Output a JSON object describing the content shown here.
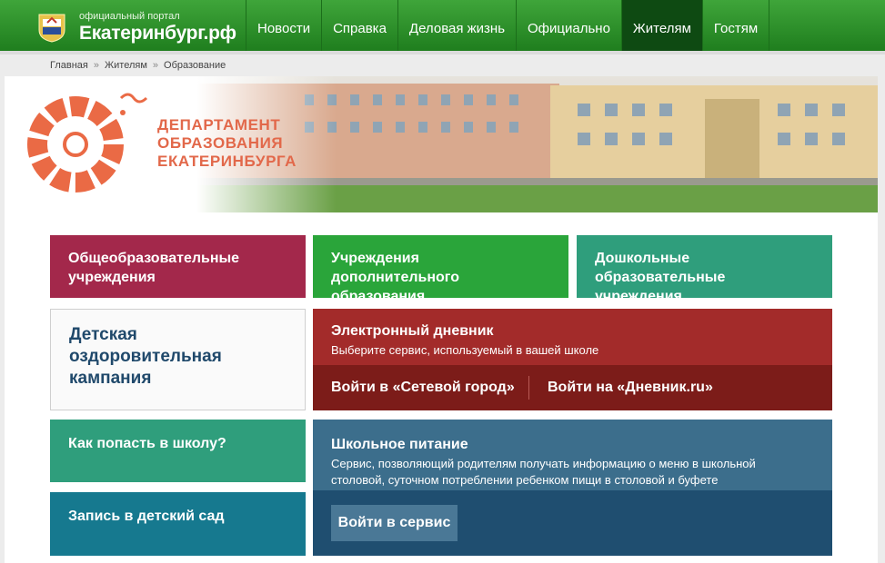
{
  "header": {
    "subtitle": "официальный портал",
    "title": "Екатеринбург.рф",
    "nav": [
      {
        "label": "Новости"
      },
      {
        "label": "Справка"
      },
      {
        "label": "Деловая жизнь"
      },
      {
        "label": "Официально"
      },
      {
        "label": "Жителям"
      },
      {
        "label": "Гостям"
      }
    ],
    "active_nav": "Жителям",
    "colors": {
      "bar": "#2a8f28",
      "active": "#0e4a12"
    }
  },
  "breadcrumb": [
    "Главная",
    "Жителям",
    "Образование"
  ],
  "breadcrumb_sep": "»",
  "banner": {
    "dept_line1": "ДЕПАРТАМЕНТ",
    "dept_line2": "ОБРАЗОВАНИЯ",
    "dept_line3": "ЕКАТЕРИНБУРГА",
    "logo_icon": "department-wreath-logo",
    "accent": "#e2684a"
  },
  "tiles": {
    "general": {
      "line1": "Общеобразовательные",
      "line2": "учреждения"
    },
    "additional": {
      "line1": "Учреждения",
      "line2": "дополнительного образования"
    },
    "preschool": {
      "line1": "Дошкольные образовательные",
      "line2": "учреждения"
    },
    "camp": {
      "line1": "Детская",
      "line2": "оздоровительная",
      "line3": "кампания"
    },
    "school_entry": {
      "label": "Как попасть в школу?"
    },
    "kindergarten": {
      "label": "Запись в детский сад"
    }
  },
  "diary": {
    "title": "Электронный дневник",
    "subtitle": "Выберите сервис, используемый в вашей школе",
    "link1": "Войти в «Сетевой город»",
    "link2": "Войти на «Дневник.ru»"
  },
  "food": {
    "title": "Школьное питание",
    "desc_line1": "Сервис, позволяющий родителям получать информацию о меню в школьной",
    "desc_line2": "столовой, суточном потреблении ребенком пищи в столовой и буфете",
    "button": "Войти в сервис"
  }
}
